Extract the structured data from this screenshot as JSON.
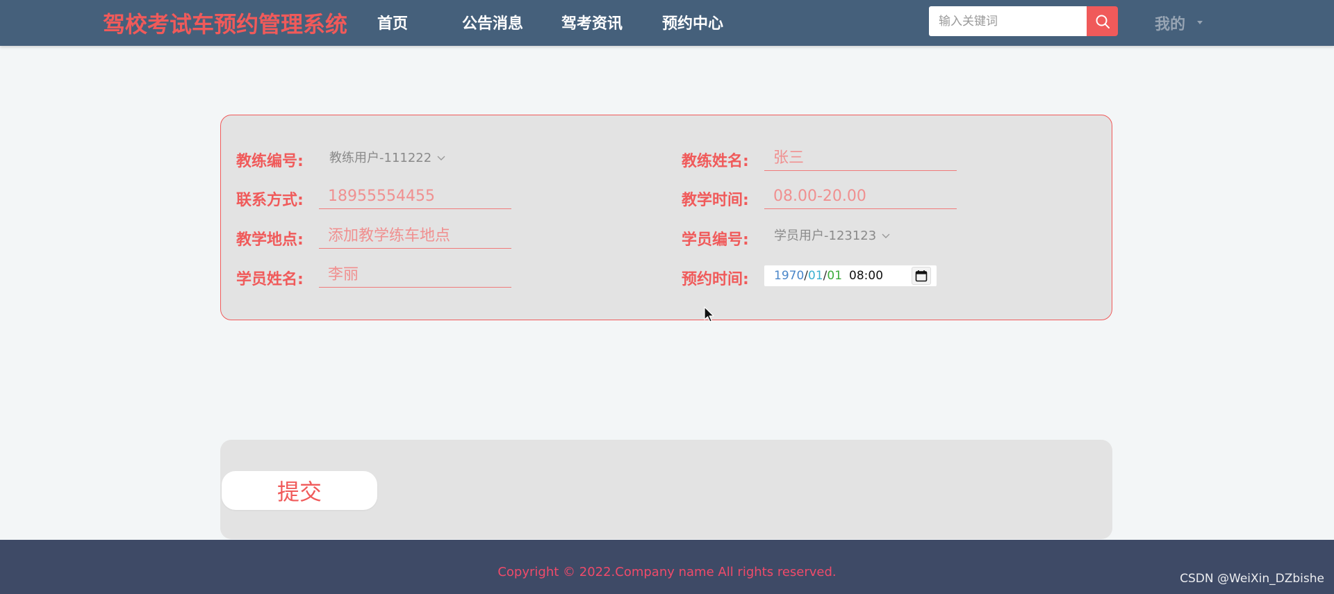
{
  "header": {
    "brand": "驾校考试车预约管理系统",
    "nav": [
      {
        "label": "首页"
      },
      {
        "label": "公告消息"
      },
      {
        "label": "驾考资讯"
      },
      {
        "label": "预约中心"
      }
    ],
    "search": {
      "placeholder": "输入关键词",
      "value": "",
      "icon": "search-icon"
    },
    "user_menu": {
      "label": "我的",
      "icon": "caret-down-icon"
    }
  },
  "form": {
    "coach_id": {
      "label": "教练编号:",
      "value": "教练用户-111222"
    },
    "coach_name": {
      "label": "教练姓名:",
      "value": "张三"
    },
    "contact": {
      "label": "联系方式:",
      "value": "18955554455"
    },
    "teaching_time": {
      "label": "教学时间:",
      "value": "08.00-20.00"
    },
    "teaching_place": {
      "label": "教学地点:",
      "value": "添加教学练车地点"
    },
    "student_id": {
      "label": "学员编号:",
      "value": "学员用户-123123"
    },
    "student_name": {
      "label": "学员姓名:",
      "value": "李丽"
    },
    "booking_time": {
      "label": "预约时间:",
      "year": "1970",
      "month": "01",
      "day": "01",
      "time": "08:00",
      "icon": "calendar-icon"
    }
  },
  "submit": {
    "label": "提交"
  },
  "footer": {
    "copyright": "Copyright © 2022.Company name All rights reserved.",
    "watermark": "CSDN @WeiXin_DZbishe"
  },
  "colors": {
    "header_bg": "#45607b",
    "accent": "#f05a5a",
    "panel_bg": "#e3e3e3",
    "footer_bg": "#3e4a66"
  }
}
